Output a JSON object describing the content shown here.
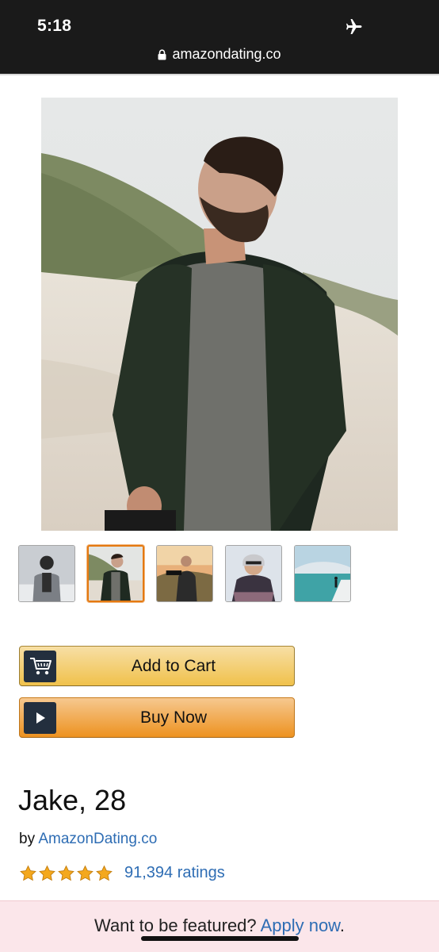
{
  "status_bar": {
    "time": "5:18",
    "airplane_icon": "airplane-icon"
  },
  "browser": {
    "url": "amazondating.co",
    "lock_icon": "lock-icon"
  },
  "gallery": {
    "thumbnails": [
      {
        "label": "photo-1",
        "selected": false
      },
      {
        "label": "photo-2",
        "selected": true
      },
      {
        "label": "photo-3",
        "selected": false
      },
      {
        "label": "photo-4",
        "selected": false
      },
      {
        "label": "photo-5",
        "selected": false
      }
    ]
  },
  "actions": {
    "add_to_cart": "Add to Cart",
    "buy_now": "Buy Now",
    "cart_icon": "cart-icon",
    "play_icon": "play-icon"
  },
  "product": {
    "title": "Jake, 28",
    "by_prefix": "by",
    "seller": "AmazonDating.co",
    "stars": 5,
    "ratings_text": "91,394 ratings"
  },
  "banner": {
    "prompt": "Want to be featured?",
    "link": "Apply now",
    "suffix": "."
  },
  "colors": {
    "link": "#2e6db4",
    "selected_border": "#e47911",
    "cart_button": "#f0c14b",
    "buy_button": "#ed9220",
    "banner_bg": "#fbe6ea"
  }
}
